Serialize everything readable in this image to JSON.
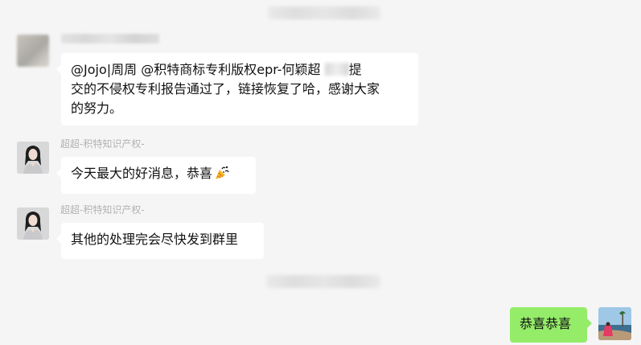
{
  "chat": {
    "msg1": {
      "line1_a": "@Jojo|周周 @积特商标专利版权epr-何颖超",
      "line1_b": "提",
      "line2": "交的不侵权专利报告通过了，链接恢复了哈，感谢大家",
      "line3": "的努力。"
    },
    "msg2": {
      "sender": "超超-积特知识产权-",
      "text": "今天最大的好消息，恭喜",
      "emoji": "party-popper"
    },
    "msg3": {
      "sender": "超超-积特知识产权-",
      "text": "其他的处理完会尽快发到群里"
    },
    "msg4": {
      "text": "恭喜恭喜"
    }
  },
  "colors": {
    "background": "#f5f5f5",
    "bubble_incoming": "#ffffff",
    "bubble_outgoing": "#95ec69",
    "sender_name": "#b2b2b2",
    "text": "#111111"
  }
}
